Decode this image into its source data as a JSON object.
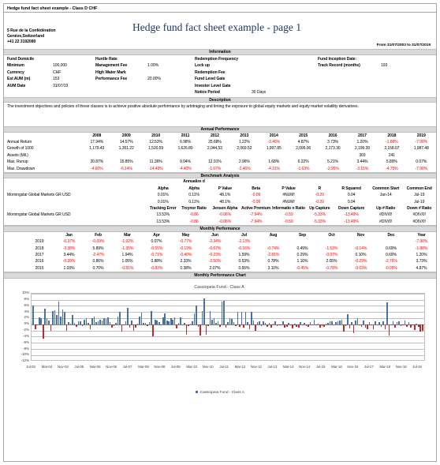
{
  "tab": {
    "label": "Hedge fund fact sheet example - Class D CHF"
  },
  "header": {
    "title": "Hedge fund fact sheet example - page 1",
    "address_line1": "5 Rue de la Confédération",
    "address_line2": "Genève,Switzerland",
    "address_line3": "+41 22 3192080",
    "date_range": "From 31/07/2003 to 31/07/2019"
  },
  "information": {
    "band": "Information",
    "col1": [
      {
        "label": "Fund Domicile",
        "value": ""
      },
      {
        "label": "Minimum",
        "value": "100,000"
      },
      {
        "label": "Currency",
        "value": "CHF"
      },
      {
        "label": "Est AUM (m)",
        "value": "153"
      },
      {
        "label": "AUM Date",
        "value": "31/07/19"
      }
    ],
    "col2": [
      {
        "label": "Hurdle Rate",
        "value": ""
      },
      {
        "label": "Management Fee",
        "value": "1.00%"
      },
      {
        "label": "High Water Mark",
        "value": ""
      },
      {
        "label": "Performance Fee",
        "value": "20.00%"
      },
      {
        "label": "",
        "value": ""
      }
    ],
    "col3": [
      {
        "label": "Redemption Frequency",
        "value": ""
      },
      {
        "label": "Lock up",
        "value": ""
      },
      {
        "label": "Redemption Fee",
        "value": ""
      },
      {
        "label": "Fund Level Gate",
        "value": ""
      },
      {
        "label": "Investor Level Gate",
        "value": ""
      },
      {
        "label": "Notice Period",
        "value": "30 Days"
      }
    ],
    "col4": [
      {
        "label": "Fund Inception Date:",
        "value": ""
      },
      {
        "label": "Track Record (months)",
        "value": "193"
      }
    ]
  },
  "description": {
    "band": "Description",
    "text": "The investment objectives and policies of these classes is to achieve positive absolute performance by arbitraging and timing the exposure to global equity markets and equity market volatility derivatives."
  },
  "annual": {
    "band": "Annual Performance",
    "years": [
      "2008",
      "2009",
      "2010",
      "2011",
      "2012",
      "2013",
      "2014",
      "2015",
      "2016",
      "2017",
      "2018",
      "2019"
    ],
    "rows": [
      {
        "label": "Annual Return",
        "values": [
          "17.94%",
          "14.57%",
          "12.53%",
          "6.98%",
          "25.68%",
          "1.22%",
          "-3.46%",
          "4.87%",
          "3.73%",
          "1.20%",
          "-1.88%",
          "-7.90%"
        ]
      },
      {
        "label": "Growth of 1000",
        "values": [
          "1,179.43",
          "1,351.22",
          "1,520.59",
          "1,626.80",
          "2,044.53",
          "2,069.52",
          "1,997.85",
          "2,095.06",
          "2,173.30",
          "2,199.39",
          "2,158.07",
          "1,987.48"
        ]
      },
      {
        "label": "Assets (Mil.)",
        "values": [
          "",
          "",
          "",
          "",
          "",
          "",
          "",
          "",
          "",
          "303",
          "241",
          ""
        ]
      },
      {
        "label": "Max. Runup",
        "values": [
          "20.87%",
          "15.85%",
          "11.36%",
          "9.04%",
          "12.91%",
          "2.96%",
          "1.68%",
          "6.22%",
          "5.21%",
          "3.44%",
          "5.89%",
          "0.07%"
        ]
      },
      {
        "label": "Max. Drawdown",
        "values": [
          "-4.60%",
          "-6.14%",
          "-14.49%",
          "-4.40%",
          "-1.67%",
          "-2.46%",
          "-4.31%",
          "-1.63%",
          "-2.95%",
          "-3.15%",
          "-4.75%",
          "-7.90%"
        ]
      }
    ]
  },
  "benchmark": {
    "band": "Benchmark Analysis",
    "headers_a": [
      "Alpha",
      "Annualize d Alpha",
      "P Value",
      "Beta",
      "P Value",
      "R",
      "R Squared",
      "Common Start",
      "Common End"
    ],
    "headers_b": [
      "Tracking Error",
      "Treynor Ratio",
      "Jensen Alpha",
      "Active Premium",
      "Informatio n Ratio",
      "Up Capture",
      "Down Capture",
      "Up # Ratio",
      "Down # Ratio"
    ],
    "rows_a": [
      {
        "label": "Morningstar Global Markets GR USD",
        "values": [
          "0.01%",
          "0.11%",
          "48.1%",
          "-0.09",
          "#NUM!",
          "-0.20",
          "0.04",
          "Jan-14",
          "Jul-19"
        ]
      },
      {
        "label": "",
        "values": [
          "0.01%",
          "0.11%",
          "48.1%",
          "-0.09",
          "#NUM!",
          "-0.20",
          "0.04",
          "",
          "Jul-19"
        ]
      }
    ],
    "rows_b": [
      {
        "label": "Morningstar Global Markets GR USD",
        "values": [
          "13.53%",
          "-0.86",
          "-0.06%",
          "-7.94%",
          "-0.59",
          "-5.33%",
          "-13.49%",
          "#DIV/0!",
          "#DIV/0!"
        ]
      },
      {
        "label": "",
        "values": [
          "13.53%",
          "-0.86",
          "-0.06%",
          "-7.94%",
          "-0.59",
          "-5.33%",
          "-13.49%",
          "#DIV/0!",
          "#DIV/0!"
        ]
      }
    ]
  },
  "monthly": {
    "band": "Monthly Performance",
    "months": [
      "Jan",
      "Feb",
      "Mar",
      "Apr",
      "May",
      "Jun",
      "Jul",
      "Aug",
      "Sep",
      "Oct",
      "Nov",
      "Dec",
      "Year"
    ],
    "rows": [
      {
        "year": "2019",
        "values": [
          "-0.37%",
          "-0.69%",
          "-1.92%",
          "0.07%",
          "-0.77%",
          "-2.34%",
          "-2.13%",
          "",
          "",
          "",
          "",
          "",
          "-7.90%"
        ]
      },
      {
        "year": "2018",
        "values": [
          "-3.38%",
          "5.89%",
          "-1.35%",
          "-0.55%",
          "-0.19%",
          "-0.67%",
          "-0.16%",
          "-0.74%",
          "0.49%",
          "-1.53%",
          "-0.14%",
          "0.69%",
          "-1.88%"
        ]
      },
      {
        "year": "2017",
        "values": [
          "3.44%",
          "-2.47%",
          "1.94%",
          "-0.71%",
          "-0.40%",
          "-0.23%",
          "1.59%",
          "-2.81%",
          "0.29%",
          "-0.07%",
          "0.10%",
          "0.69%",
          "1.20%"
        ]
      },
      {
        "year": "2016",
        "values": [
          "-0.39%",
          "0.86%",
          "1.05%",
          "0.88%",
          "2.33%",
          "-2.50%",
          "0.53%",
          "0.78%",
          "1.16%",
          "2.05%",
          "-0.29%",
          "-2.76%",
          "3.73%"
        ]
      },
      {
        "year": "2015",
        "values": [
          "1.03%",
          "0.70%",
          "-0.81%",
          "-0.83%",
          "0.38%",
          "2.07%",
          "0.55%",
          "3.10%",
          "-0.45%",
          "-0.78%",
          "-0.03%",
          "-0.09%",
          "4.87%"
        ]
      }
    ]
  },
  "chart_data": {
    "type": "bar",
    "band": "Monthly Performance Chart",
    "title": "Cassiopeia Fund - Class A",
    "legend": [
      "Cassiopeia Fund - Class A"
    ],
    "legend_position": "bottom",
    "grid": true,
    "xlabel": "",
    "ylabel": "",
    "ylim": [
      -12,
      10
    ],
    "yticks": [
      "10%",
      "8%",
      "6%",
      "4%",
      "2%",
      "0%",
      "-2%",
      "-4%",
      "-6%",
      "-8%",
      "-10%",
      "-12%"
    ],
    "xticks": [
      "Jul-03",
      "Mar-04",
      "Nov-04",
      "Jul-05",
      "Mar-06",
      "Nov-06",
      "Jul-07",
      "Mar-08",
      "Nov-08",
      "Jul-09",
      "Mar-10",
      "Nov-10",
      "Jul-11",
      "Mar-12",
      "Nov-12",
      "Jul-13",
      "Mar-14",
      "Nov-14",
      "Jul-15",
      "Mar-16",
      "Nov-16",
      "Jul-17",
      "Mar-18",
      "Nov-18",
      "Jul-19"
    ],
    "positive_color": "#4472a8",
    "negative_color": "#c0282d",
    "values": [
      6.1,
      -1.6,
      -0.2,
      2.2,
      1.9,
      -4.6,
      5.0,
      2.0,
      1.3,
      -2.0,
      4.4,
      4.5,
      3.1,
      7.4,
      2.4,
      4.7,
      4.1,
      -2.2,
      0.6,
      0.2,
      3.1,
      0.5,
      -0.8,
      0.9,
      1.1,
      -0.5,
      1.5,
      2.0,
      0.4,
      -1.5,
      2.1,
      2.6,
      0.8,
      1.1,
      1.6,
      1.3,
      2.1,
      1.7,
      2.2,
      0.8,
      -1.2,
      -0.6,
      0.5,
      2.6,
      4.1,
      -2.4,
      -0.3,
      1.1,
      5.3,
      -1.0,
      1.3,
      -2.0,
      -1.1,
      0.3,
      2.4,
      3.8,
      0.5,
      0.4,
      -0.6,
      0.7,
      4.4,
      -3.8,
      1.5,
      1.2,
      0.6,
      -0.4,
      2.2,
      3.6,
      1.3,
      0.9,
      2.0,
      1.4,
      2.2,
      -1.3,
      0.5,
      2.3,
      -0.4,
      0.4,
      -3.4,
      -0.6,
      0.2,
      1.1,
      3.6,
      6.1,
      -0.7,
      -3.6,
      4.2,
      8.4,
      -3.3,
      -0.6,
      4.2,
      1.5,
      2.0,
      0.5,
      1.0,
      -0.8,
      7.3,
      7.5,
      -1.2,
      0.6,
      2.0,
      1.7,
      0.7,
      -0.5,
      4.0,
      -0.7,
      4.1,
      -1.1,
      4.1,
      0.6,
      -1.6,
      4.1,
      1.2,
      -2.2,
      0.6,
      0.9,
      -0.6,
      1.0,
      0.4,
      -0.7,
      0.5,
      -1.0,
      0.3,
      0.9,
      -0.5,
      -0.4,
      -0.2,
      0.9,
      -1.1,
      -0.8,
      0.4,
      -0.3,
      -1.4,
      0.2,
      -0.8,
      -1.0,
      0.6,
      -0.3,
      0.4,
      -0.5,
      -0.8,
      0.8,
      -0.4,
      1.6,
      -0.3,
      0.2,
      -1.0,
      -0.5,
      -0.9,
      0.2,
      0.5,
      0.9,
      1.0,
      -0.2,
      0.6,
      1.0,
      1.3,
      1.5,
      -2.3,
      -0.6,
      3.4,
      -1.4,
      0.8,
      -2.8,
      1.3,
      2.1,
      -0.3,
      -0.9,
      1.2,
      -1.2,
      -1.6,
      0.6,
      -0.4,
      -1.5,
      0.9,
      -0.3,
      0.6,
      -0.7,
      1.0,
      -1.5,
      7.0,
      -3.6,
      -0.4,
      0.9,
      -1.0,
      0.7,
      0.9,
      -0.6,
      -0.3,
      1.2,
      -0.7,
      0.6,
      -1.1,
      -0.4,
      -1.9,
      0.1,
      -0.8,
      -2.3,
      -2.1
    ]
  }
}
